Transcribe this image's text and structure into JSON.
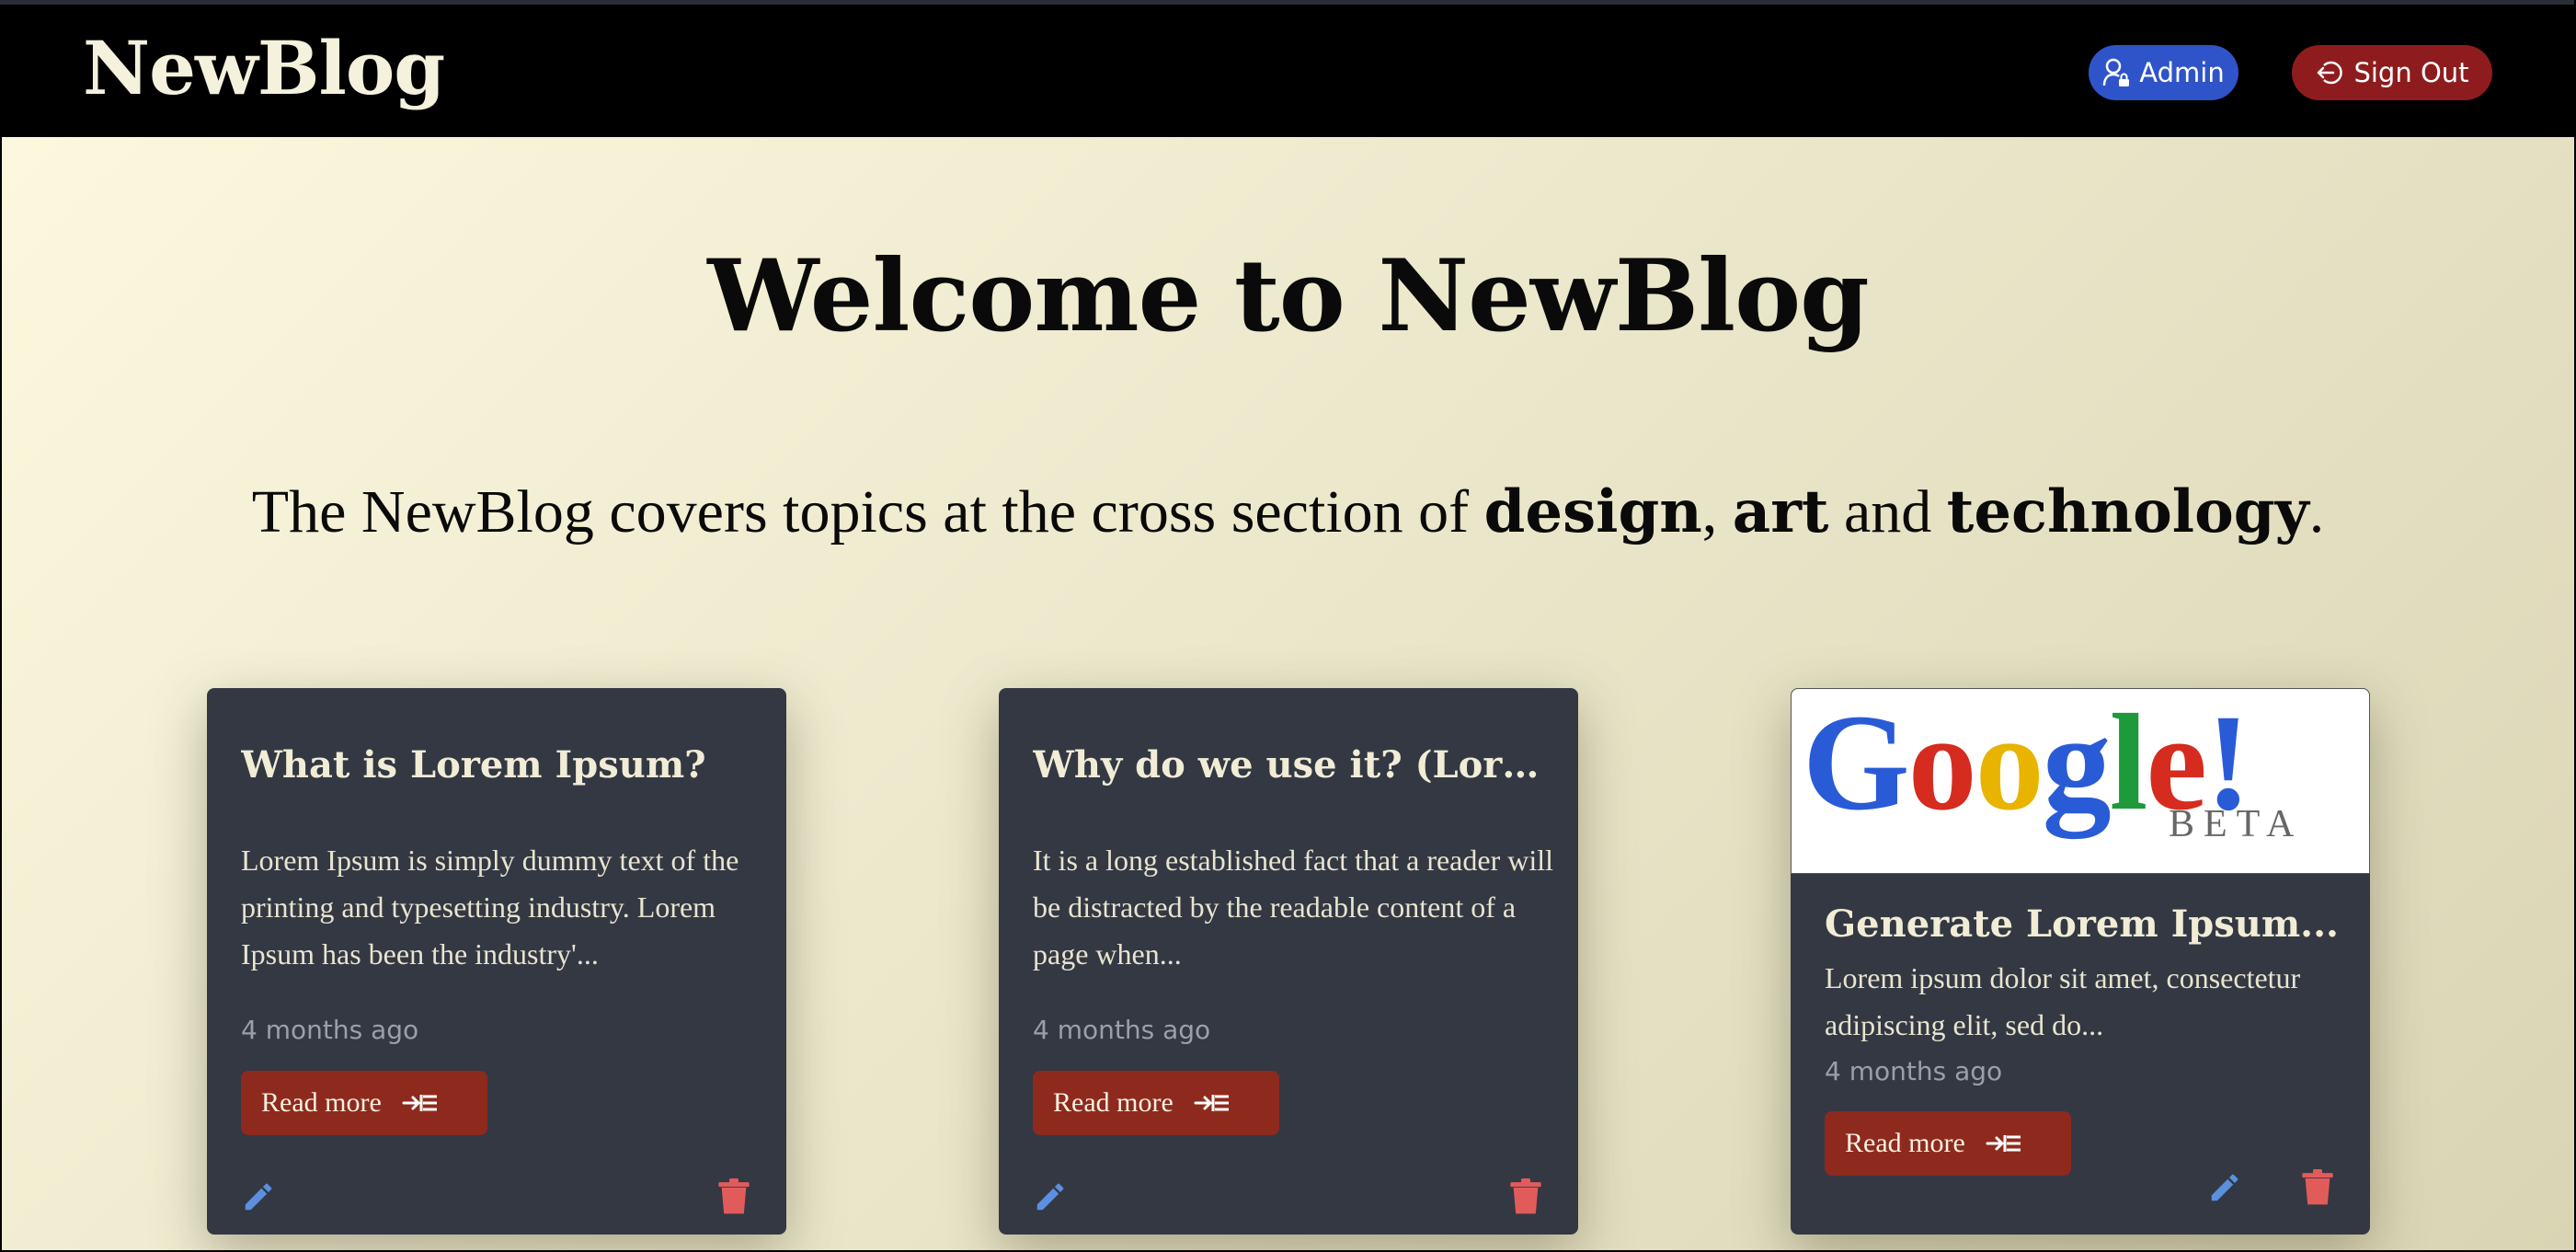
{
  "brand": "NewBlog",
  "nav": {
    "admin_label": "Admin",
    "signout_label": "Sign Out"
  },
  "hero": {
    "title": "Welcome to NewBlog",
    "subtitle_prefix": "The NewBlog covers topics at the cross section of ",
    "topic_1": "design",
    "sep_1": ", ",
    "topic_2": "art",
    "sep_2": " and ",
    "topic_3": "technology",
    "suffix": "."
  },
  "cards": [
    {
      "title": "What is Lorem Ipsum?",
      "excerpt": "Lorem Ipsum is simply dummy text of the printing and typesetting industry. Lorem Ipsum has been the industry'...",
      "date": "4 months ago",
      "read_more": "Read more"
    },
    {
      "title": "Why do we use it? (Lore...",
      "excerpt": "It is a long established fact that a reader will be distracted by the readable content of a page when...",
      "date": "4 months ago",
      "read_more": "Read more"
    },
    {
      "title": "Generate Lorem Ipsum...",
      "excerpt": "Lorem ipsum dolor sit amet, consectetur adipiscing elit, sed do...",
      "date": "4 months ago",
      "read_more": "Read more",
      "image": {
        "logo_text": "Google!",
        "logo_sub": "BETA"
      }
    }
  ],
  "colors": {
    "admin": "#2f54c9",
    "signout": "#8e1c1f",
    "card_bg": "#333843",
    "read_more": "#8e2a1d",
    "edit_icon": "#5b8fe0",
    "delete_icon": "#e25b5b"
  },
  "icons": {
    "admin": "user-lock-icon",
    "signout": "sign-out-icon",
    "read_more": "arrow-list-icon",
    "edit": "pencil-icon",
    "delete": "trash-icon"
  }
}
